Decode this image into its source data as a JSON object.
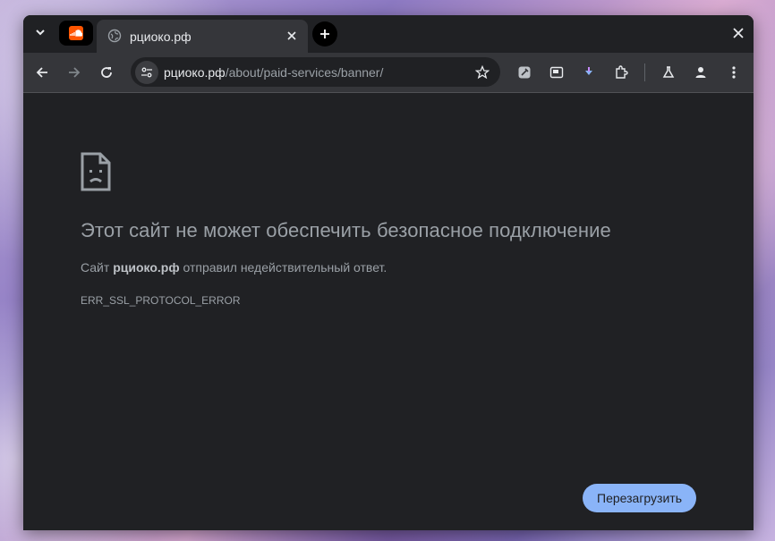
{
  "tab": {
    "title": "рциоко.рф",
    "favicon": "globe-icon"
  },
  "pinned_tab": {
    "favicon": "soundcloud-icon",
    "color": "#ff5500"
  },
  "omnibox": {
    "host": "рциоко.рф",
    "path": "/about/paid-services/banner/"
  },
  "error": {
    "heading": "Этот сайт не может обеспечить безопасное подключение",
    "desc_prefix": "Сайт ",
    "desc_host": "рциоко.рф",
    "desc_suffix": " отправил недействительный ответ.",
    "code": "ERR_SSL_PROTOCOL_ERROR"
  },
  "reload_button": {
    "label": "Перезагрузить",
    "color": "#8ab4f8"
  },
  "theme": {
    "frame": "#202124",
    "toolbar": "#35363a",
    "text": "#e8eaed",
    "muted": "#9aa0a6"
  }
}
